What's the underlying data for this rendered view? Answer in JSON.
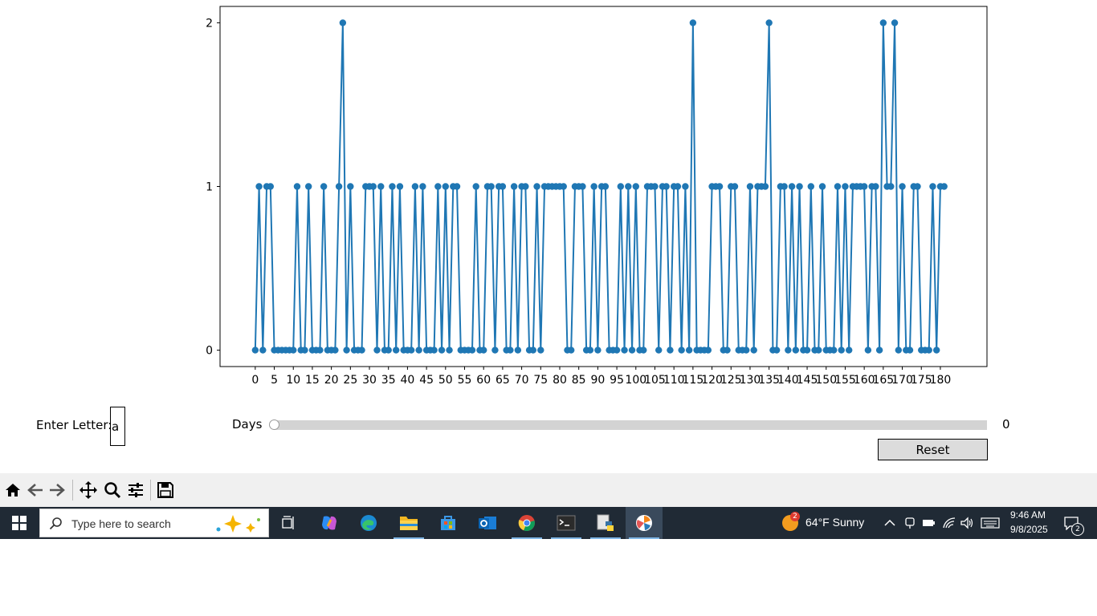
{
  "chart_data": {
    "type": "line",
    "marker": "circle",
    "color": "#1f77b4",
    "x_start": 0,
    "x_end": 182,
    "x_ticks": [
      0,
      5,
      10,
      15,
      20,
      25,
      30,
      35,
      40,
      45,
      50,
      55,
      60,
      65,
      70,
      75,
      80,
      85,
      90,
      95,
      100,
      105,
      110,
      115,
      120,
      125,
      130,
      135,
      140,
      145,
      150,
      155,
      160,
      165,
      170,
      175,
      180
    ],
    "y_ticks": [
      0,
      1,
      2
    ],
    "xlim": [
      -9.25,
      192.25
    ],
    "ylim": [
      -0.1,
      2.1
    ],
    "values": [
      0,
      1,
      0,
      1,
      1,
      0,
      0,
      0,
      0,
      0,
      0,
      1,
      0,
      0,
      1,
      0,
      0,
      0,
      1,
      0,
      0,
      0,
      1,
      2,
      0,
      1,
      0,
      0,
      0,
      1,
      1,
      1,
      0,
      1,
      0,
      0,
      1,
      0,
      1,
      0,
      0,
      0,
      1,
      0,
      1,
      0,
      0,
      0,
      1,
      0,
      1,
      0,
      1,
      1,
      0,
      0,
      0,
      0,
      1,
      0,
      0,
      1,
      1,
      0,
      1,
      1,
      0,
      0,
      1,
      0,
      1,
      1,
      0,
      0,
      1,
      0,
      1,
      1,
      1,
      1,
      1,
      1,
      0,
      0,
      1,
      1,
      1,
      0,
      0,
      1,
      0,
      1,
      1,
      0,
      0,
      0,
      1,
      0,
      1,
      0,
      1,
      0,
      0,
      1,
      1,
      1,
      0,
      1,
      1,
      0,
      1,
      1,
      0,
      1,
      0,
      2,
      0,
      0,
      0,
      0,
      1,
      1,
      1,
      0,
      0,
      1,
      1,
      0,
      0,
      0,
      1,
      0,
      1,
      1,
      1,
      2,
      0,
      0,
      1,
      1,
      0,
      1,
      0,
      1,
      0,
      0,
      1,
      0,
      0,
      1,
      0,
      0,
      0,
      1,
      0,
      1,
      0,
      1,
      1,
      1,
      1,
      0,
      1,
      1,
      0,
      2,
      1,
      1,
      2,
      0,
      1,
      0,
      0,
      1,
      1,
      0,
      0,
      0,
      1,
      0,
      1,
      1
    ]
  },
  "controls": {
    "letter_label": "Enter Letter:",
    "letter_value": "a",
    "slider_label": "Days",
    "slider_value": "0",
    "slider_fraction": 0,
    "reset_label": "Reset"
  },
  "toolbar": {
    "icons": [
      "home-icon",
      "back-icon",
      "forward-icon",
      "pan-icon",
      "zoom-icon",
      "configure-icon",
      "save-icon"
    ]
  },
  "taskbar": {
    "search_placeholder": "Type here to search",
    "weather_badge": "2",
    "weather": "64°F  Sunny",
    "time": "9:46 AM",
    "date": "9/8/2025",
    "notifications": "2",
    "accent": "#7fb6e6"
  }
}
